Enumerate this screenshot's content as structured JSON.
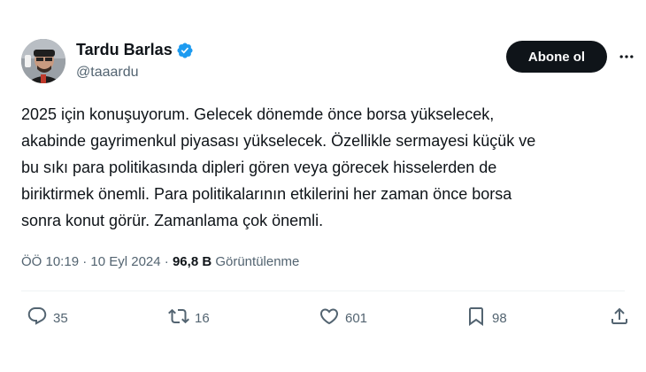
{
  "author": {
    "name": "Tardu Barlas",
    "handle": "@taaardu"
  },
  "buttons": {
    "follow_label": "Abone ol"
  },
  "tweet": {
    "lines": [
      "2025 için konuşuyorum. Gelecek dönemde önce borsa yükselecek,",
      "akabinde gayrimenkul piyasası yükselecek. Özellikle sermayesi küçük ve",
      "bu sıkı para politikasında dipleri gören veya görecek hisselerden de",
      "biriktirmek önemli. Para politikalarının etkilerini her zaman önce borsa",
      "sonra konut görür. Zamanlama çok önemli."
    ]
  },
  "meta": {
    "time": "ÖÖ 10:19",
    "separator": " · ",
    "date": "10 Eyl 2024",
    "views_count": "96,8 B",
    "views_label": " Görüntülenme"
  },
  "actions": {
    "replies": "35",
    "reposts": "16",
    "likes": "601",
    "bookmarks": "98"
  },
  "icons": {
    "verified": "verified-badge-icon",
    "more": "more-horizontal-icon",
    "reply": "reply-icon",
    "repost": "repost-icon",
    "like": "heart-icon",
    "bookmark": "bookmark-icon",
    "share": "share-icon"
  },
  "colors": {
    "verified_blue": "#1d9bf0",
    "text_primary": "#0f1419",
    "text_secondary": "#536471",
    "button_bg": "#0f1419",
    "button_text": "#ffffff"
  }
}
